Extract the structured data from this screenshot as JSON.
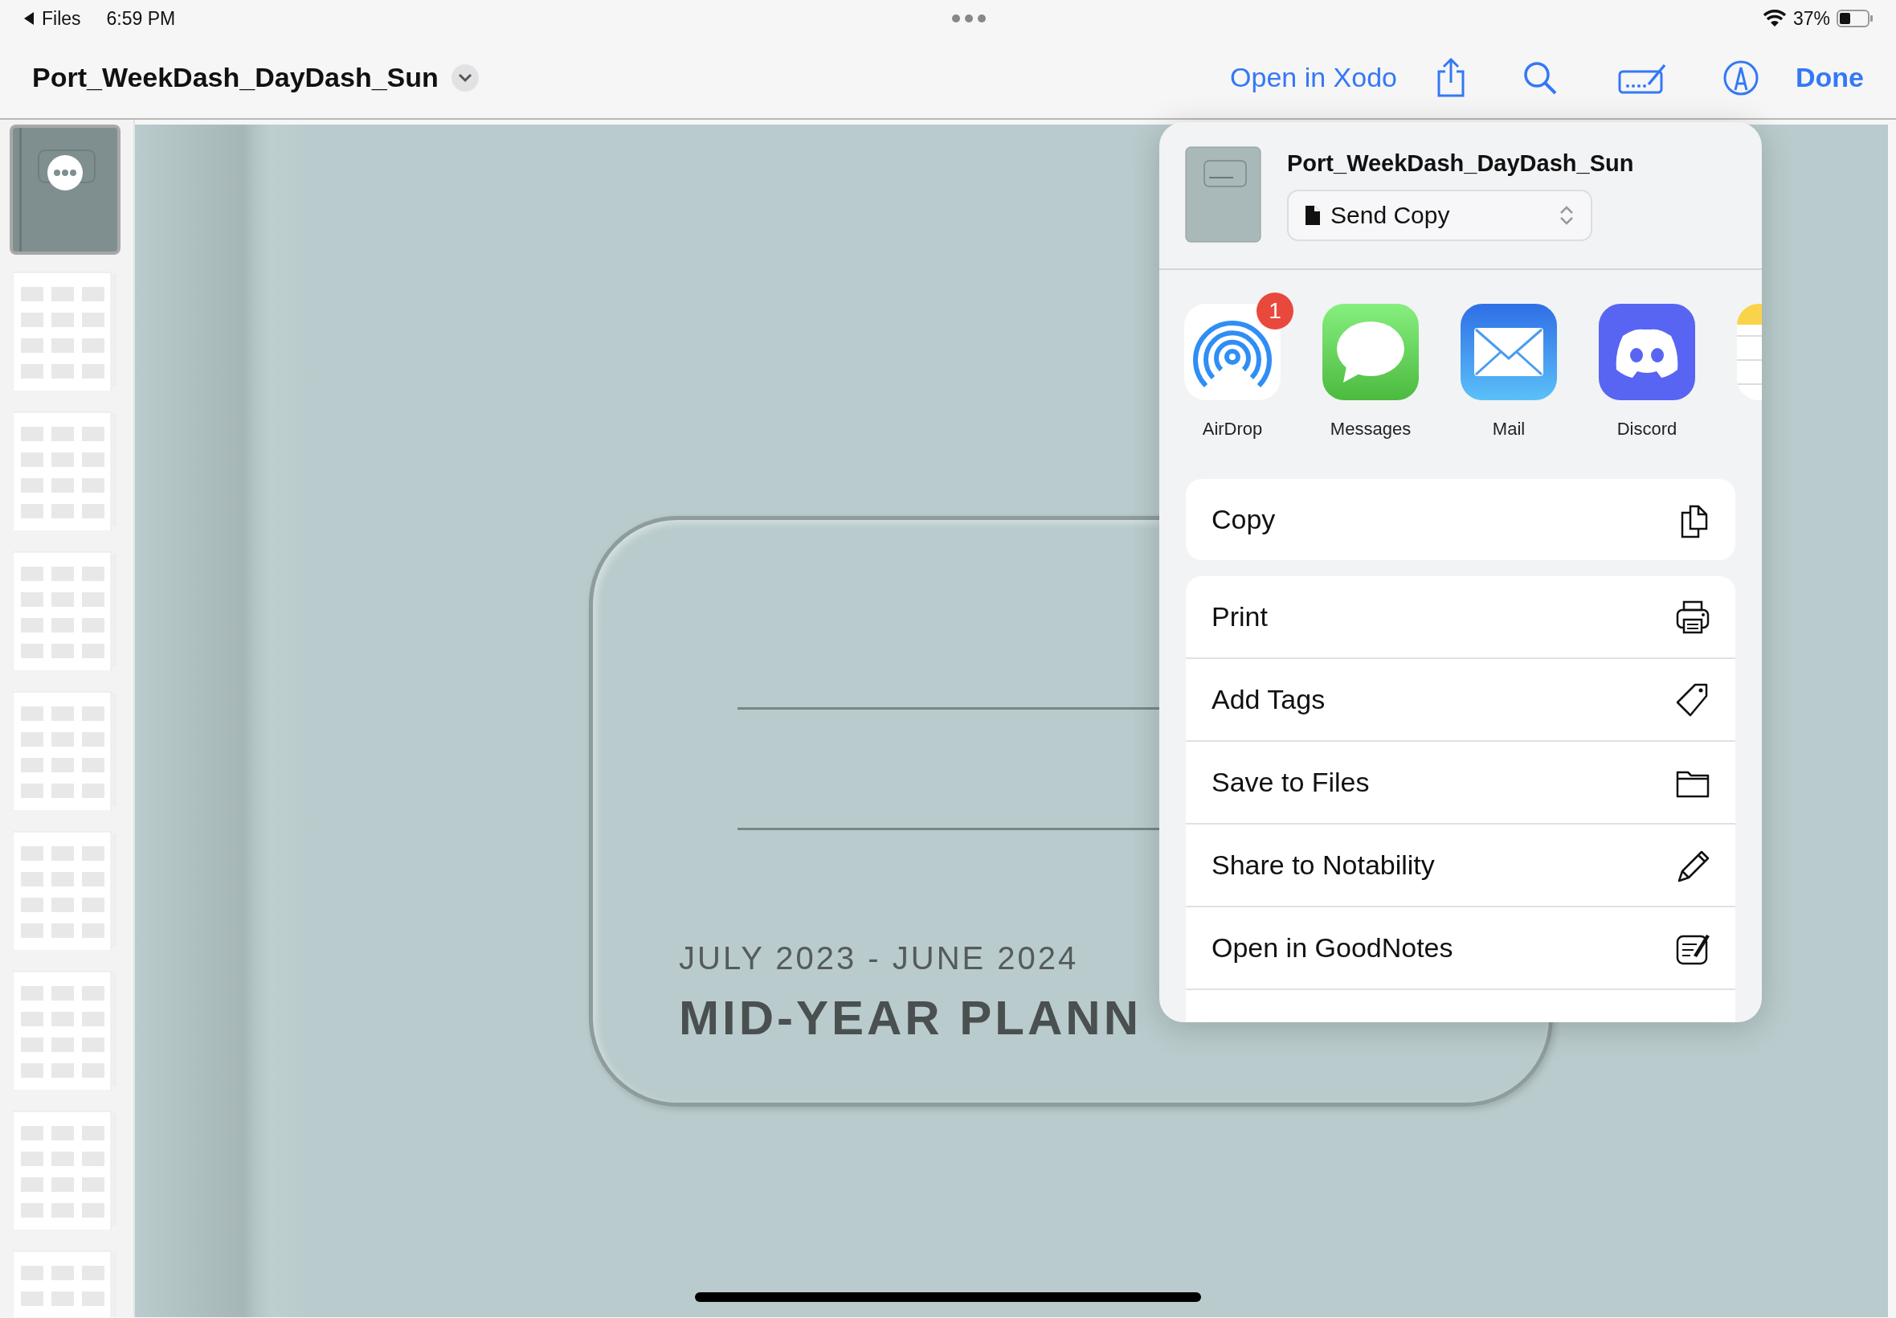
{
  "status_bar": {
    "back_label": "Files",
    "time": "6:59 PM",
    "battery": "37%"
  },
  "toolbar": {
    "title": "Port_WeekDash_DayDash_Sun",
    "open_in": "Open in Xodo",
    "done": "Done"
  },
  "thumbnails": [
    {
      "kind": "cover",
      "selected": true
    },
    {
      "kind": "page",
      "selected": false
    },
    {
      "kind": "page",
      "selected": false
    },
    {
      "kind": "page",
      "selected": false
    },
    {
      "kind": "page",
      "selected": false
    },
    {
      "kind": "page",
      "selected": false
    },
    {
      "kind": "page",
      "selected": false
    },
    {
      "kind": "page",
      "selected": false
    },
    {
      "kind": "page",
      "selected": false
    }
  ],
  "document": {
    "subtitle": "JULY 2023 - JUNE 2024",
    "title": "MID-YEAR PLANN"
  },
  "share_sheet": {
    "file_name": "Port_WeekDash_DayDash_Sun",
    "mode": "Send Copy",
    "apps": [
      {
        "kind": "airdrop",
        "label": "AirDrop",
        "badge": "1"
      },
      {
        "kind": "messages",
        "label": "Messages"
      },
      {
        "kind": "mail",
        "label": "Mail"
      },
      {
        "kind": "discord",
        "label": "Discord"
      },
      {
        "kind": "notes"
      }
    ],
    "action_groups": [
      [
        {
          "kind": "copy",
          "label": "Copy"
        }
      ],
      [
        {
          "kind": "print",
          "label": "Print"
        },
        {
          "kind": "tag",
          "label": "Add Tags"
        },
        {
          "kind": "folder",
          "label": "Save to Files"
        },
        {
          "kind": "pencil",
          "label": "Share to Notability"
        },
        {
          "kind": "note-edit",
          "label": "Open in GoodNotes"
        }
      ]
    ]
  }
}
